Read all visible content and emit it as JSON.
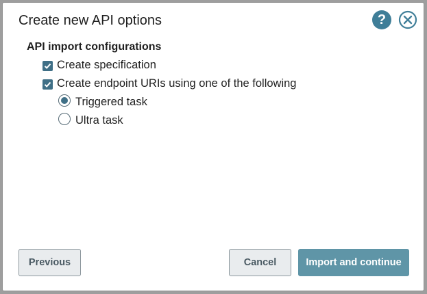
{
  "dialog": {
    "title": "Create new API options",
    "help_icon": "?",
    "section_title": "API import configurations",
    "options": {
      "create_specification": {
        "label": "Create specification",
        "checked": true
      },
      "create_endpoint_uris": {
        "label": "Create endpoint URIs using one of the following",
        "checked": true
      }
    },
    "radios": {
      "triggered_task": {
        "label": "Triggered task",
        "selected": true
      },
      "ultra_task": {
        "label": "Ultra task",
        "selected": false
      }
    },
    "buttons": {
      "previous": "Previous",
      "cancel": "Cancel",
      "import_and_continue": "Import and continue"
    }
  },
  "colors": {
    "accent": "#3f7e98",
    "checkbox": "#3f6f86",
    "primary_button": "#5f95a7",
    "secondary_button": "#e9ecee"
  },
  "icons": [
    "help-icon",
    "close-icon",
    "checkmark-icon"
  ]
}
